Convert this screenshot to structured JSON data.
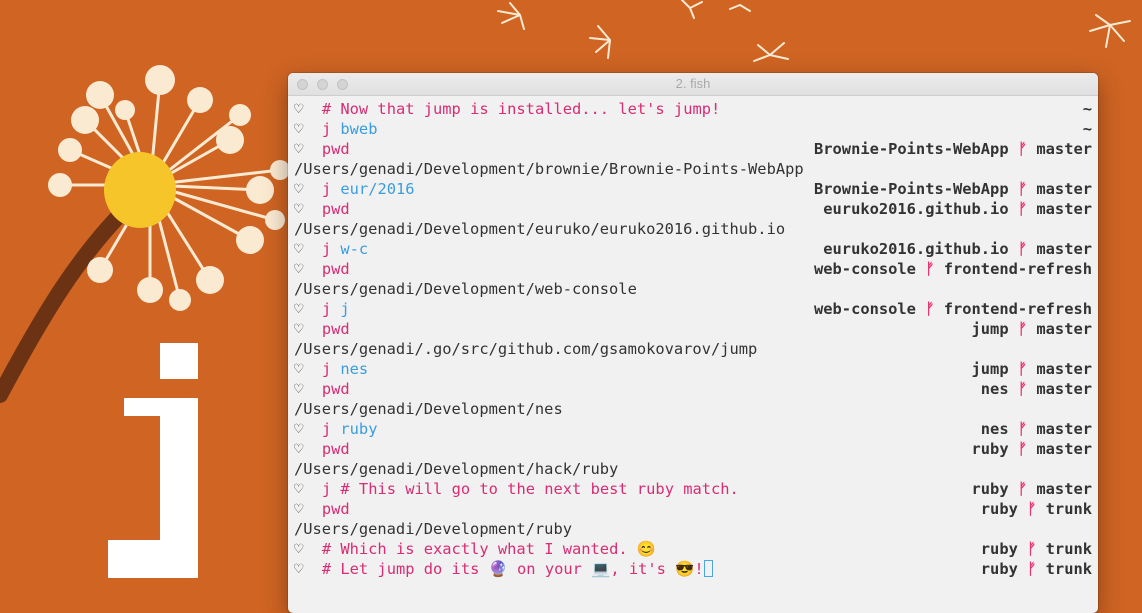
{
  "window": {
    "title": "2. fish"
  },
  "prompt": {
    "symbol": "♡",
    "branch_icon": "git-branch-icon"
  },
  "colors": {
    "background": "#cf6423",
    "command": "#d82c74",
    "argument": "#3a9de0",
    "terminal_bg": "#f1f1f1",
    "branch_glyph": "#e8356f"
  },
  "lines": [
    {
      "type": "prompt",
      "cmd": "",
      "arg": "",
      "comment": "# Now that jump is installed... let's jump!",
      "dir": "~",
      "branch": ""
    },
    {
      "type": "prompt",
      "cmd": "j",
      "arg": "bweb",
      "comment": "",
      "dir": "~",
      "branch": ""
    },
    {
      "type": "prompt",
      "cmd": "pwd",
      "arg": "",
      "comment": "",
      "dir": "Brownie-Points-WebApp",
      "branch": "master"
    },
    {
      "type": "output",
      "text": "/Users/genadi/Development/brownie/Brownie-Points-WebApp"
    },
    {
      "type": "prompt",
      "cmd": "j",
      "arg": "eur/2016",
      "comment": "",
      "dir": "Brownie-Points-WebApp",
      "branch": "master"
    },
    {
      "type": "prompt",
      "cmd": "pwd",
      "arg": "",
      "comment": "",
      "dir": "euruko2016.github.io",
      "branch": "master"
    },
    {
      "type": "output",
      "text": "/Users/genadi/Development/euruko/euruko2016.github.io"
    },
    {
      "type": "prompt",
      "cmd": "j",
      "arg": "w-c",
      "comment": "",
      "dir": "euruko2016.github.io",
      "branch": "master"
    },
    {
      "type": "prompt",
      "cmd": "pwd",
      "arg": "",
      "comment": "",
      "dir": "web-console",
      "branch": "frontend-refresh"
    },
    {
      "type": "output",
      "text": "/Users/genadi/Development/web-console"
    },
    {
      "type": "prompt",
      "cmd": "j",
      "arg": "j",
      "comment": "",
      "dir": "web-console",
      "branch": "frontend-refresh"
    },
    {
      "type": "prompt",
      "cmd": "pwd",
      "arg": "",
      "comment": "",
      "dir": "jump",
      "branch": "master"
    },
    {
      "type": "output",
      "text": "/Users/genadi/.go/src/github.com/gsamokovarov/jump"
    },
    {
      "type": "prompt",
      "cmd": "j",
      "arg": "nes",
      "comment": "",
      "dir": "jump",
      "branch": "master"
    },
    {
      "type": "prompt",
      "cmd": "pwd",
      "arg": "",
      "comment": "",
      "dir": "nes",
      "branch": "master"
    },
    {
      "type": "output",
      "text": "/Users/genadi/Development/nes"
    },
    {
      "type": "prompt",
      "cmd": "j",
      "arg": "ruby",
      "comment": "",
      "dir": "nes",
      "branch": "master"
    },
    {
      "type": "prompt",
      "cmd": "pwd",
      "arg": "",
      "comment": "",
      "dir": "ruby",
      "branch": "master"
    },
    {
      "type": "output",
      "text": "/Users/genadi/Development/hack/ruby"
    },
    {
      "type": "prompt",
      "cmd": "j",
      "arg": "",
      "comment": "# This will go to the next best ruby match.",
      "dir": "ruby",
      "branch": "master"
    },
    {
      "type": "prompt",
      "cmd": "pwd",
      "arg": "",
      "comment": "",
      "dir": "ruby",
      "branch": "trunk"
    },
    {
      "type": "output",
      "text": "/Users/genadi/Development/ruby"
    },
    {
      "type": "prompt",
      "cmd": "",
      "arg": "",
      "comment": "# Which is exactly what I wanted. 😊",
      "dir": "ruby",
      "branch": "trunk"
    },
    {
      "type": "prompt",
      "cmd": "",
      "arg": "",
      "comment": "# Let jump do its 🔮 on your 💻, it's 😎!",
      "dir": "ruby",
      "branch": "trunk",
      "cursor": true
    }
  ]
}
